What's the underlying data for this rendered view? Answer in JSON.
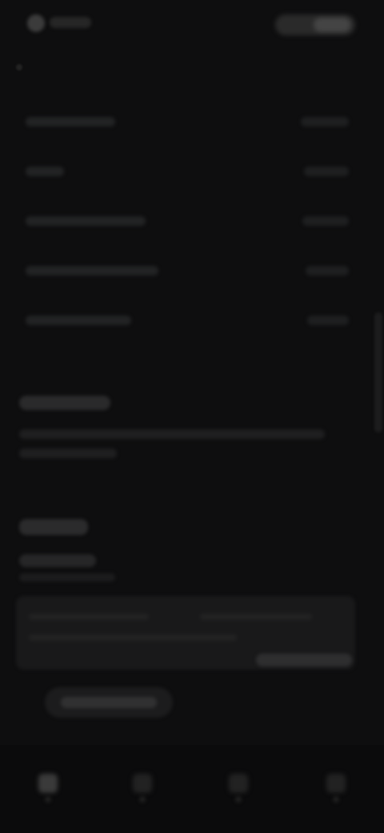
{
  "app": {
    "title": "",
    "header_action_label": ""
  },
  "settings": {
    "rows": [
      {
        "label": "",
        "value": ""
      },
      {
        "label": "",
        "value": ""
      },
      {
        "label": "",
        "value": ""
      },
      {
        "label": "",
        "value": ""
      },
      {
        "label": "",
        "value": ""
      }
    ]
  },
  "about": {
    "heading": "",
    "description": ""
  },
  "feedback": {
    "heading": "",
    "subheading": "",
    "hint": "",
    "input_placeholder": "",
    "submit_label": "",
    "secondary_button_label": ""
  },
  "bottom_nav": {
    "items": [
      {
        "label": "",
        "icon": "home-icon",
        "active": true
      },
      {
        "label": "",
        "icon": "search-icon",
        "active": false
      },
      {
        "label": "",
        "icon": "notifications-icon",
        "active": false
      },
      {
        "label": "",
        "icon": "profile-icon",
        "active": false
      }
    ]
  },
  "theme": {
    "background": "#0e0e0f",
    "surface": "#19191a",
    "text_muted": "#9a9a9a"
  }
}
